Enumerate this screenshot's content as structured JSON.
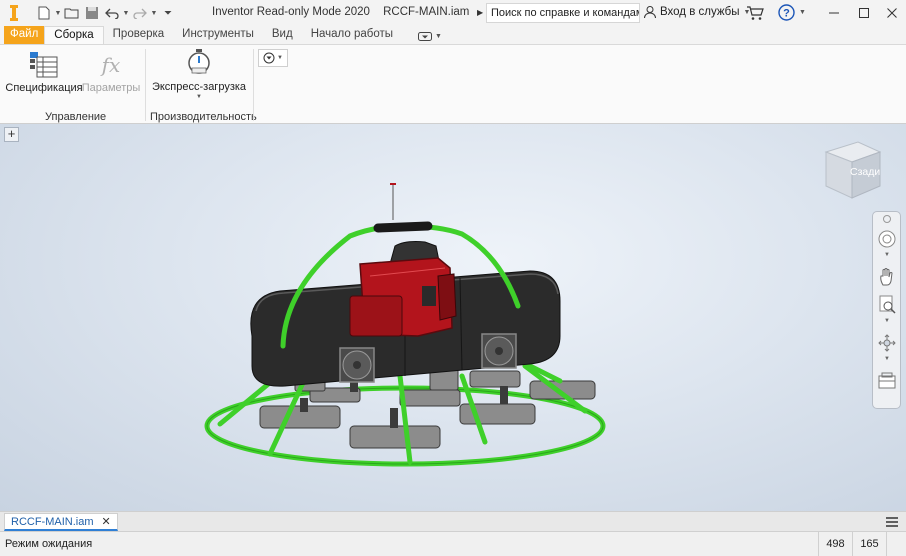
{
  "titlebar": {
    "app_name": "Inventor Read-only Mode 2020",
    "document_name": "RCCF-MAIN.iam",
    "search_placeholder": "Поиск по справке и командам.",
    "signin_label": "Вход в службы"
  },
  "tabs": [
    {
      "label": "Файл"
    },
    {
      "label": "Сборка"
    },
    {
      "label": "Проверка"
    },
    {
      "label": "Инструменты"
    },
    {
      "label": "Вид"
    },
    {
      "label": "Начало работы"
    }
  ],
  "ribbon": {
    "manage": {
      "title": "Управление",
      "bom_label": "Спецификация",
      "params_label": "Параметры"
    },
    "productivity": {
      "title": "Производительность",
      "express_label": "Экспресс-загрузка"
    }
  },
  "viewport": {
    "viewcube_face": "Сзади"
  },
  "document_tabs": [
    {
      "label": "RCCF-MAIN.iam"
    }
  ],
  "statusbar": {
    "status": "Режим ожидания",
    "value1": "498",
    "value2": "165"
  },
  "colors": {
    "file_tab": "#f5a41b",
    "frame_green": "#3fd02a",
    "engine_red": "#b3141c",
    "body_dark": "#2b2b2b"
  }
}
